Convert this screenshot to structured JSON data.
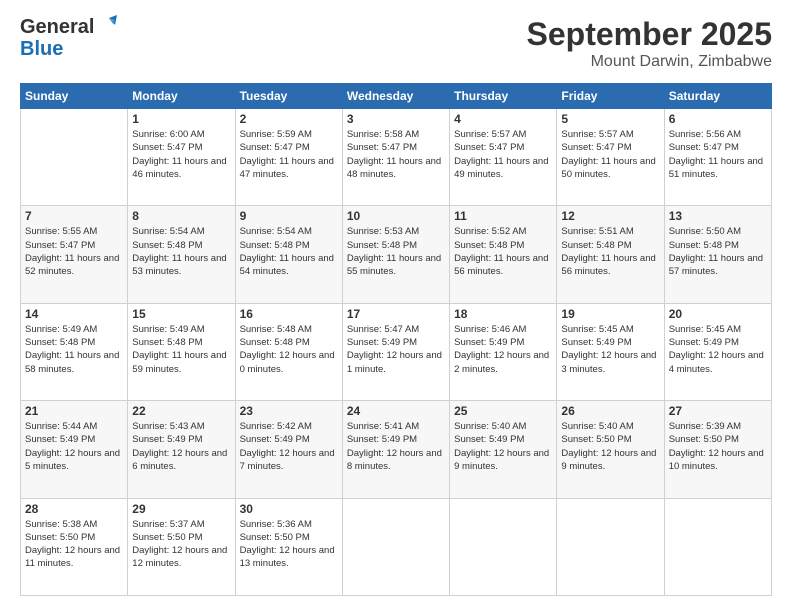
{
  "logo": {
    "line1": "General",
    "line2": "Blue"
  },
  "header": {
    "month": "September 2025",
    "location": "Mount Darwin, Zimbabwe"
  },
  "weekdays": [
    "Sunday",
    "Monday",
    "Tuesday",
    "Wednesday",
    "Thursday",
    "Friday",
    "Saturday"
  ],
  "weeks": [
    [
      {
        "day": "",
        "sunrise": "",
        "sunset": "",
        "daylight": ""
      },
      {
        "day": "1",
        "sunrise": "Sunrise: 6:00 AM",
        "sunset": "Sunset: 5:47 PM",
        "daylight": "Daylight: 11 hours and 46 minutes."
      },
      {
        "day": "2",
        "sunrise": "Sunrise: 5:59 AM",
        "sunset": "Sunset: 5:47 PM",
        "daylight": "Daylight: 11 hours and 47 minutes."
      },
      {
        "day": "3",
        "sunrise": "Sunrise: 5:58 AM",
        "sunset": "Sunset: 5:47 PM",
        "daylight": "Daylight: 11 hours and 48 minutes."
      },
      {
        "day": "4",
        "sunrise": "Sunrise: 5:57 AM",
        "sunset": "Sunset: 5:47 PM",
        "daylight": "Daylight: 11 hours and 49 minutes."
      },
      {
        "day": "5",
        "sunrise": "Sunrise: 5:57 AM",
        "sunset": "Sunset: 5:47 PM",
        "daylight": "Daylight: 11 hours and 50 minutes."
      },
      {
        "day": "6",
        "sunrise": "Sunrise: 5:56 AM",
        "sunset": "Sunset: 5:47 PM",
        "daylight": "Daylight: 11 hours and 51 minutes."
      }
    ],
    [
      {
        "day": "7",
        "sunrise": "Sunrise: 5:55 AM",
        "sunset": "Sunset: 5:47 PM",
        "daylight": "Daylight: 11 hours and 52 minutes."
      },
      {
        "day": "8",
        "sunrise": "Sunrise: 5:54 AM",
        "sunset": "Sunset: 5:48 PM",
        "daylight": "Daylight: 11 hours and 53 minutes."
      },
      {
        "day": "9",
        "sunrise": "Sunrise: 5:54 AM",
        "sunset": "Sunset: 5:48 PM",
        "daylight": "Daylight: 11 hours and 54 minutes."
      },
      {
        "day": "10",
        "sunrise": "Sunrise: 5:53 AM",
        "sunset": "Sunset: 5:48 PM",
        "daylight": "Daylight: 11 hours and 55 minutes."
      },
      {
        "day": "11",
        "sunrise": "Sunrise: 5:52 AM",
        "sunset": "Sunset: 5:48 PM",
        "daylight": "Daylight: 11 hours and 56 minutes."
      },
      {
        "day": "12",
        "sunrise": "Sunrise: 5:51 AM",
        "sunset": "Sunset: 5:48 PM",
        "daylight": "Daylight: 11 hours and 56 minutes."
      },
      {
        "day": "13",
        "sunrise": "Sunrise: 5:50 AM",
        "sunset": "Sunset: 5:48 PM",
        "daylight": "Daylight: 11 hours and 57 minutes."
      }
    ],
    [
      {
        "day": "14",
        "sunrise": "Sunrise: 5:49 AM",
        "sunset": "Sunset: 5:48 PM",
        "daylight": "Daylight: 11 hours and 58 minutes."
      },
      {
        "day": "15",
        "sunrise": "Sunrise: 5:49 AM",
        "sunset": "Sunset: 5:48 PM",
        "daylight": "Daylight: 11 hours and 59 minutes."
      },
      {
        "day": "16",
        "sunrise": "Sunrise: 5:48 AM",
        "sunset": "Sunset: 5:48 PM",
        "daylight": "Daylight: 12 hours and 0 minutes."
      },
      {
        "day": "17",
        "sunrise": "Sunrise: 5:47 AM",
        "sunset": "Sunset: 5:49 PM",
        "daylight": "Daylight: 12 hours and 1 minute."
      },
      {
        "day": "18",
        "sunrise": "Sunrise: 5:46 AM",
        "sunset": "Sunset: 5:49 PM",
        "daylight": "Daylight: 12 hours and 2 minutes."
      },
      {
        "day": "19",
        "sunrise": "Sunrise: 5:45 AM",
        "sunset": "Sunset: 5:49 PM",
        "daylight": "Daylight: 12 hours and 3 minutes."
      },
      {
        "day": "20",
        "sunrise": "Sunrise: 5:45 AM",
        "sunset": "Sunset: 5:49 PM",
        "daylight": "Daylight: 12 hours and 4 minutes."
      }
    ],
    [
      {
        "day": "21",
        "sunrise": "Sunrise: 5:44 AM",
        "sunset": "Sunset: 5:49 PM",
        "daylight": "Daylight: 12 hours and 5 minutes."
      },
      {
        "day": "22",
        "sunrise": "Sunrise: 5:43 AM",
        "sunset": "Sunset: 5:49 PM",
        "daylight": "Daylight: 12 hours and 6 minutes."
      },
      {
        "day": "23",
        "sunrise": "Sunrise: 5:42 AM",
        "sunset": "Sunset: 5:49 PM",
        "daylight": "Daylight: 12 hours and 7 minutes."
      },
      {
        "day": "24",
        "sunrise": "Sunrise: 5:41 AM",
        "sunset": "Sunset: 5:49 PM",
        "daylight": "Daylight: 12 hours and 8 minutes."
      },
      {
        "day": "25",
        "sunrise": "Sunrise: 5:40 AM",
        "sunset": "Sunset: 5:49 PM",
        "daylight": "Daylight: 12 hours and 9 minutes."
      },
      {
        "day": "26",
        "sunrise": "Sunrise: 5:40 AM",
        "sunset": "Sunset: 5:50 PM",
        "daylight": "Daylight: 12 hours and 9 minutes."
      },
      {
        "day": "27",
        "sunrise": "Sunrise: 5:39 AM",
        "sunset": "Sunset: 5:50 PM",
        "daylight": "Daylight: 12 hours and 10 minutes."
      }
    ],
    [
      {
        "day": "28",
        "sunrise": "Sunrise: 5:38 AM",
        "sunset": "Sunset: 5:50 PM",
        "daylight": "Daylight: 12 hours and 11 minutes."
      },
      {
        "day": "29",
        "sunrise": "Sunrise: 5:37 AM",
        "sunset": "Sunset: 5:50 PM",
        "daylight": "Daylight: 12 hours and 12 minutes."
      },
      {
        "day": "30",
        "sunrise": "Sunrise: 5:36 AM",
        "sunset": "Sunset: 5:50 PM",
        "daylight": "Daylight: 12 hours and 13 minutes."
      },
      {
        "day": "",
        "sunrise": "",
        "sunset": "",
        "daylight": ""
      },
      {
        "day": "",
        "sunrise": "",
        "sunset": "",
        "daylight": ""
      },
      {
        "day": "",
        "sunrise": "",
        "sunset": "",
        "daylight": ""
      },
      {
        "day": "",
        "sunrise": "",
        "sunset": "",
        "daylight": ""
      }
    ]
  ]
}
